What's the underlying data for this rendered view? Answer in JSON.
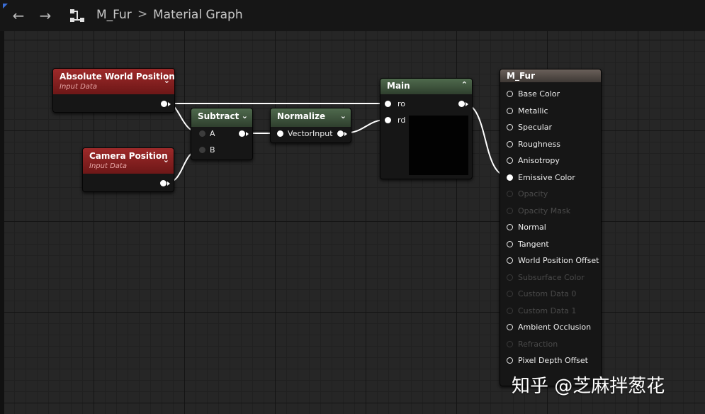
{
  "breadcrumb": {
    "asset": "M_Fur",
    "separator": ">",
    "section": "Material Graph"
  },
  "nav": {
    "back_icon": "arrow-left-icon",
    "forward_icon": "arrow-right-icon",
    "graph_icon": "graph-icon"
  },
  "nodes": {
    "absolute_world_position": {
      "title": "Absolute World Position",
      "subtitle": "Input Data"
    },
    "camera_position": {
      "title": "Camera Position",
      "subtitle": "Input Data"
    },
    "subtract": {
      "title": "Subtract",
      "inputs": [
        "A",
        "B"
      ]
    },
    "normalize": {
      "title": "Normalize",
      "input": "VectorInput"
    },
    "main": {
      "title": "Main",
      "inputs": [
        "ro",
        "rd"
      ]
    },
    "m_fur": {
      "title": "M_Fur",
      "pins": [
        {
          "label": "Base Color",
          "active": true
        },
        {
          "label": "Metallic",
          "active": true
        },
        {
          "label": "Specular",
          "active": true
        },
        {
          "label": "Roughness",
          "active": true
        },
        {
          "label": "Anisotropy",
          "active": true
        },
        {
          "label": "Emissive Color",
          "active": true
        },
        {
          "label": "Opacity",
          "active": false
        },
        {
          "label": "Opacity Mask",
          "active": false
        },
        {
          "label": "Normal",
          "active": true
        },
        {
          "label": "Tangent",
          "active": true
        },
        {
          "label": "World Position Offset",
          "active": true
        },
        {
          "label": "Subsurface Color",
          "active": false
        },
        {
          "label": "Custom Data 0",
          "active": false
        },
        {
          "label": "Custom Data 1",
          "active": false
        },
        {
          "label": "Ambient Occlusion",
          "active": true
        },
        {
          "label": "Refraction",
          "active": false
        },
        {
          "label": "Pixel Depth Offset",
          "active": true
        }
      ]
    }
  },
  "watermark": "知乎 @芝麻拌葱花",
  "colors": {
    "input_header": "#8e2323",
    "function_header": "#445a42",
    "result_header": "#5a514c",
    "wire": "#ffffff"
  }
}
